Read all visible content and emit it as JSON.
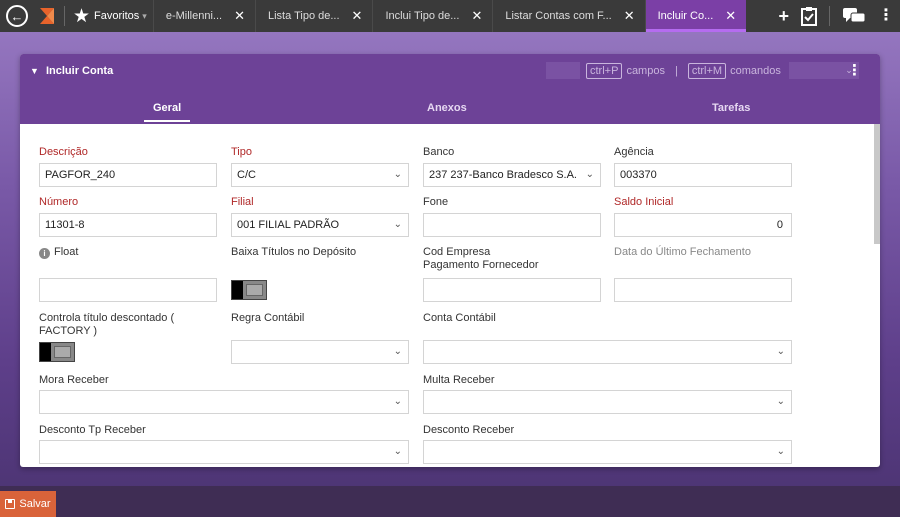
{
  "topbar": {
    "favorites_label": "Favoritos",
    "tabs": [
      {
        "label": "e-Millenni..."
      },
      {
        "label": "Lista Tipo de..."
      },
      {
        "label": "Inclui Tipo de..."
      },
      {
        "label": "Listar Contas com F..."
      },
      {
        "label": "Incluir Co...",
        "active": true
      }
    ]
  },
  "panel": {
    "title": "Incluir Conta",
    "shortcut_fields_key": "ctrl+P",
    "shortcut_fields_label": "campos",
    "shortcut_commands_key": "ctrl+M",
    "shortcut_commands_label": "comandos",
    "tabs": [
      "Geral",
      "Anexos",
      "Tarefas"
    ]
  },
  "form": {
    "descricao": {
      "label": "Descrição",
      "value": "PAGFOR_240"
    },
    "tipo": {
      "label": "Tipo",
      "value": "C/C"
    },
    "banco": {
      "label": "Banco",
      "value": "237 237-Banco Bradesco S.A."
    },
    "agencia": {
      "label": "Agência",
      "value": "003370"
    },
    "numero": {
      "label": "Número",
      "value": "11301-8"
    },
    "filial": {
      "label": "Filial",
      "value": "001 FILIAL PADRÃO"
    },
    "fone": {
      "label": "Fone",
      "value": ""
    },
    "saldo_inicial": {
      "label": "Saldo Inicial",
      "value": "0"
    },
    "float": {
      "label": "Float",
      "value": ""
    },
    "baixa_titulos": {
      "label": "Baixa Títulos no Depósito"
    },
    "cod_empresa": {
      "label_line1": "Cod Empresa",
      "label_line2": "Pagamento Fornecedor",
      "value": ""
    },
    "data_ultimo_fechamento": {
      "label": "Data do Último Fechamento",
      "value": ""
    },
    "controla_titulo": {
      "label_line1": "Controla título descontado (",
      "label_line2": "FACTORY )"
    },
    "regra_contabil": {
      "label": "Regra Contábil",
      "value": ""
    },
    "conta_contabil": {
      "label": "Conta Contábil",
      "value": ""
    },
    "mora_receber": {
      "label": "Mora Receber",
      "value": ""
    },
    "multa_receber": {
      "label": "Multa Receber",
      "value": ""
    },
    "desconto_tp_receber": {
      "label": "Desconto Tp Receber",
      "value": ""
    },
    "desconto_receber": {
      "label": "Desconto Receber",
      "value": ""
    }
  },
  "footer": {
    "save_label": "Salvar"
  },
  "colors": {
    "accent": "#6d4297",
    "required": "#b02828",
    "save": "#d9633a"
  }
}
